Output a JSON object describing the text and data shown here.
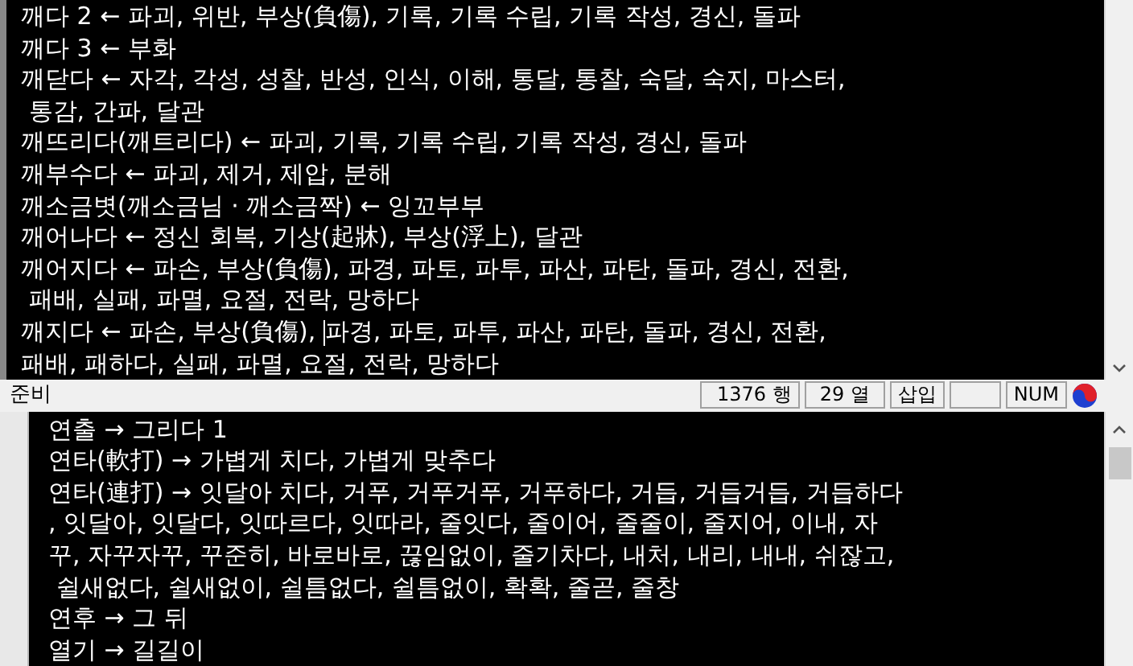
{
  "top_editor": {
    "lines": [
      {
        "text": "깨다 2 ← 파괴, 위반, 부상(負傷), 기록, 기록 수립, 기록 작성, 경신, 돌파"
      },
      {
        "text": "깨다 3 ← 부화"
      },
      {
        "text": "깨닫다 ← 자각, 각성, 성찰, 반성, 인식, 이해, 통달, 통찰, 숙달, 숙지, 마스터,"
      },
      {
        "text": " 통감, 간파, 달관"
      },
      {
        "text": "깨뜨리다(깨트리다) ← 파괴, 기록, 기록 수립, 기록 작성, 경신, 돌파"
      },
      {
        "text": "깨부수다 ← 파괴, 제거, 제압, 분해"
      },
      {
        "text": "깨소금볏(깨소금님 · 깨소금짝) ← 잉꼬부부"
      },
      {
        "text": "깨어나다 ← 정신 회복, 기상(起牀), 부상(浮上), 달관"
      },
      {
        "text": "깨어지다 ← 파손, 부상(負傷), 파경, 파토, 파투, 파산, 파탄, 돌파, 경신, 전환,"
      },
      {
        "text": " 패배, 실패, 파멸, 요절, 전락, 망하다"
      },
      {
        "kind": "cursor",
        "parts": [
          "깨지다 ← 파손, 부상(負傷), ",
          "파경, 파토, 파투, 파산, 파탄, 돌파, 경신, 전환,"
        ]
      },
      {
        "text": "패배, 패하다, 실패, 파멸, 요절, 전락, 망하다"
      }
    ]
  },
  "status_bar": {
    "message": "준비",
    "line": "1376 행",
    "column": "29 열",
    "mode": "삽입",
    "num": "NUM"
  },
  "bottom_editor": {
    "lines": [
      {
        "text": "연출 → 그리다 1"
      },
      {
        "text": "연타(軟打) → 가볍게 치다, 가볍게 맞추다"
      },
      {
        "text": "연타(連打) → 잇달아 치다, 거푸, 거푸거푸, 거푸하다, 거듭, 거듭거듭, 거듭하다"
      },
      {
        "text": ", 잇달아, 잇달다, 잇따르다, 잇따라, 줄잇다, 줄이어, 줄줄이, 줄지어, 이내, 자"
      },
      {
        "text": "꾸, 자꾸자꾸, 꾸준히, 바로바로, 끊임없이, 줄기차다, 내처, 내리, 내내, 쉬잖고,"
      },
      {
        "text": " 쉴새없다, 쉴새없이, 쉴틈없다, 쉴틈없이, 확확, 줄곧, 줄창"
      },
      {
        "text": "연후 → 그 뒤"
      },
      {
        "text": "열기 → 길길이"
      }
    ]
  }
}
